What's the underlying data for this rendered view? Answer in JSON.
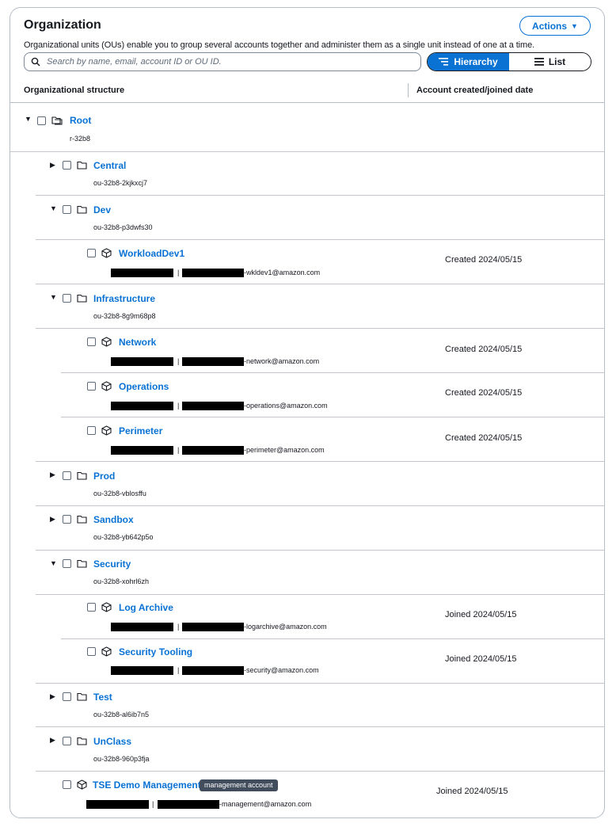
{
  "header": {
    "title": "Organization",
    "actions_label": "Actions",
    "description": "Organizational units (OUs) enable you to group several accounts together and administer them as a single unit instead of one at a time."
  },
  "search": {
    "placeholder": "Search by name, email, account ID or OU ID."
  },
  "view_toggle": {
    "hierarchy_label": "Hierarchy",
    "list_label": "List",
    "selected": "Hierarchy"
  },
  "columns": {
    "structure": "Organizational structure",
    "date": "Account created/joined date"
  },
  "tree": {
    "root": {
      "name": "Root",
      "id": "r-32b8"
    },
    "central": {
      "name": "Central",
      "id": "ou-32b8-2kjkxcj7"
    },
    "dev": {
      "name": "Dev",
      "id": "ou-32b8-p3dwfs30"
    },
    "workloaddev1": {
      "name": "WorkloadDev1",
      "email": "-wkldev1@amazon.com",
      "date": "Created 2024/05/15"
    },
    "infrastructure": {
      "name": "Infrastructure",
      "id": "ou-32b8-8g9m68p8"
    },
    "network": {
      "name": "Network",
      "email": "-network@amazon.com",
      "date": "Created 2024/05/15"
    },
    "operations": {
      "name": "Operations",
      "email": "-operations@amazon.com",
      "date": "Created 2024/05/15"
    },
    "perimeter": {
      "name": "Perimeter",
      "email": "-perimeter@amazon.com",
      "date": "Created 2024/05/15"
    },
    "prod": {
      "name": "Prod",
      "id": "ou-32b8-vblosffu"
    },
    "sandbox": {
      "name": "Sandbox",
      "id": "ou-32b8-yb642p5o"
    },
    "security": {
      "name": "Security",
      "id": "ou-32b8-xohrl6zh"
    },
    "logarchive": {
      "name": "Log Archive",
      "email": "-logarchive@amazon.com",
      "date": "Joined 2024/05/15"
    },
    "securitytooling": {
      "name": "Security Tooling",
      "email": "-security@amazon.com",
      "date": "Joined 2024/05/15"
    },
    "test": {
      "name": "Test",
      "id": "ou-32b8-al6ib7n5"
    },
    "unclass": {
      "name": "UnClass",
      "id": "ou-32b8-960p3fja"
    },
    "tsedemo": {
      "name": "TSE Demo Management",
      "badge": "management account",
      "email": "-management@amazon.com",
      "date": "Joined 2024/05/15"
    }
  },
  "separator": "|",
  "icons": {
    "expanded": "caret-down-icon",
    "collapsed": "caret-right-icon",
    "ou": "folder-icon",
    "root": "root-folder-icon",
    "account": "cube-icon"
  },
  "colors": {
    "link": "#0972d3",
    "text": "#16191f",
    "border": "#b6bec9"
  }
}
